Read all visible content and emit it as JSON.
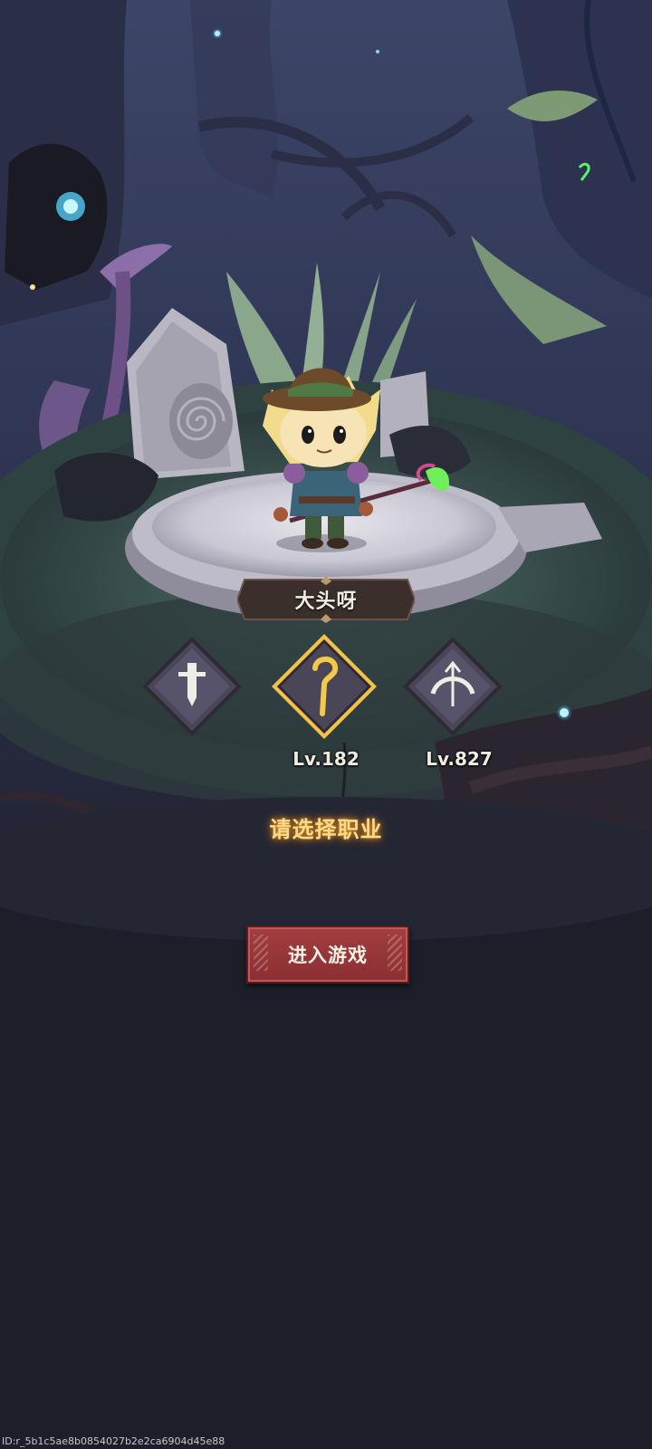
{
  "character": {
    "name": "大头呀"
  },
  "classes": [
    {
      "icon": "sword-icon",
      "level": "",
      "selected": false
    },
    {
      "icon": "staff-icon",
      "level": "Lv.182",
      "selected": true
    },
    {
      "icon": "bow-icon",
      "level": "Lv.827",
      "selected": false
    }
  ],
  "prompt": "请选择职业",
  "enter_button": {
    "label": "进入游戏"
  },
  "footer_id": "ID:r_5b1c5ae8b0854027b2e2ca6904d45e88",
  "colors": {
    "accent_gold": "#f0c24a",
    "button_red": "#8f3236",
    "background": "#1b1c27"
  }
}
